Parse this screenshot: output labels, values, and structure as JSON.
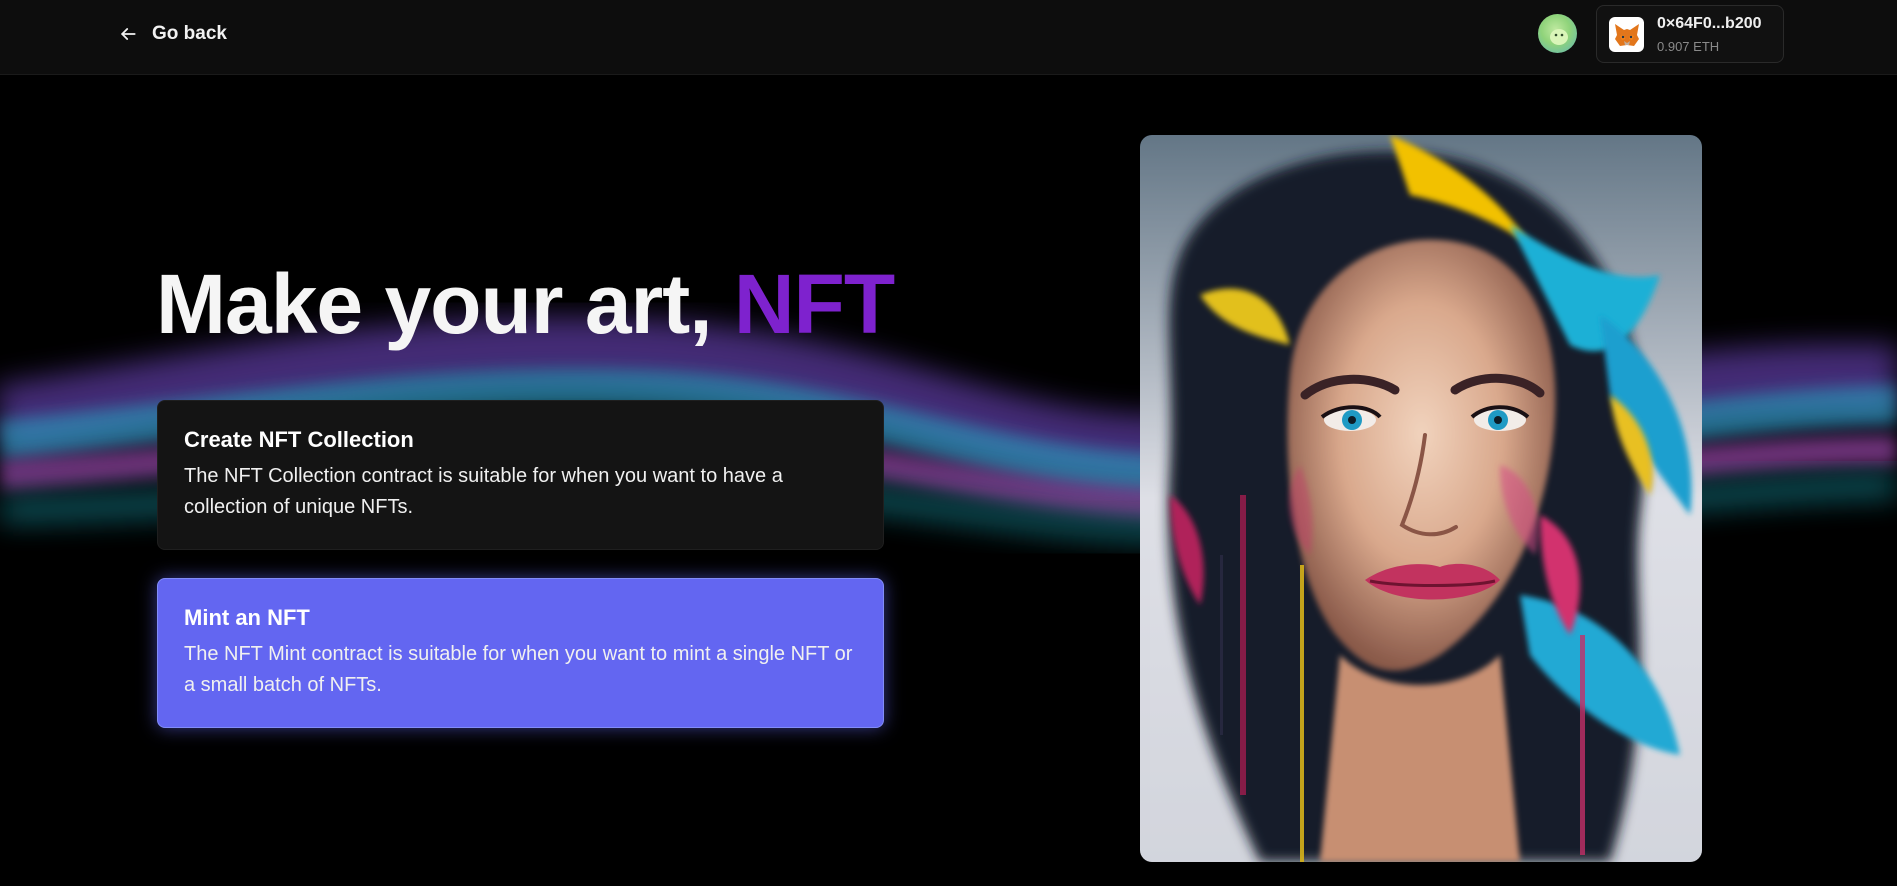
{
  "header": {
    "back_label": "Go back",
    "wallet": {
      "address": "0×64F0...b200",
      "balance": "0.907 ETH"
    }
  },
  "hero": {
    "title_main": "Make your art, ",
    "title_accent": "NFT",
    "accent_color": "#7e22ce"
  },
  "options": [
    {
      "title": "Create NFT Collection",
      "description": "The NFT Collection contract is suitable for when you want to have a collection of unique NFTs."
    },
    {
      "title": "Mint an NFT",
      "description": "The NFT Mint contract is suitable for when you want to mint a single NFT or a small batch of NFTs."
    }
  ],
  "colors": {
    "background": "#000000",
    "card_dark": "#141414",
    "card_selected": "#6366f1"
  },
  "icons": {
    "back": "arrow-left-icon",
    "wallet": "metamask-fox-icon",
    "avatar": "user-avatar"
  }
}
